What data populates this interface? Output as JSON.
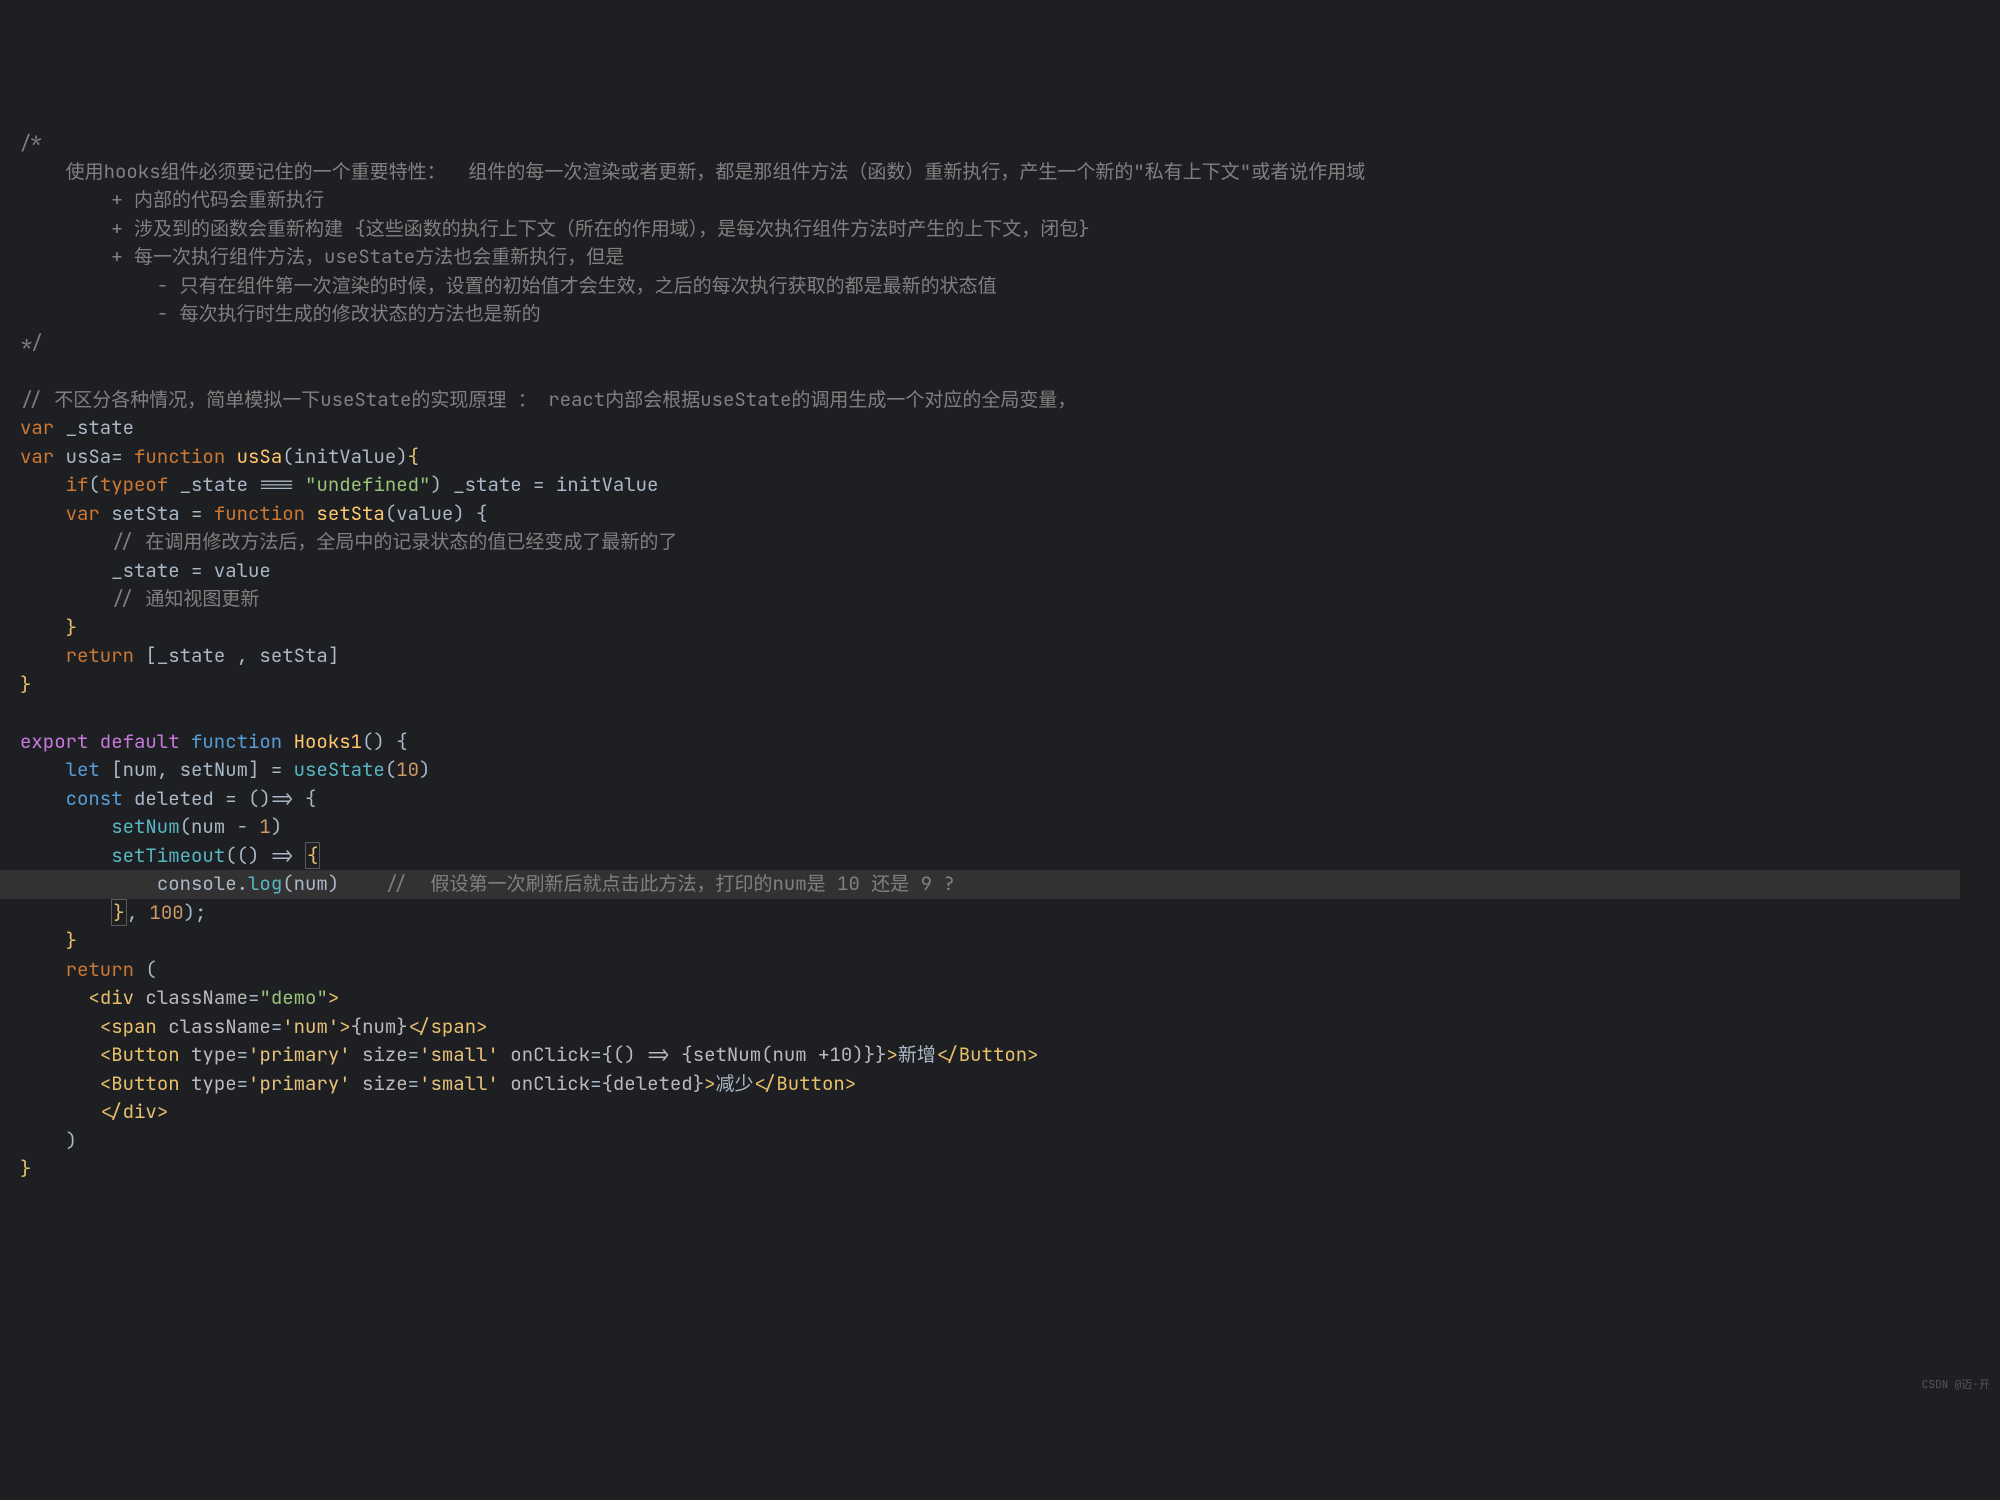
{
  "watermark": "CSDN @迈·开",
  "code": {
    "l1": "/*",
    "l2": "    使用hooks组件必须要记住的一个重要特性：  组件的每一次渲染或者更新，都是那组件方法（函数）重新执行，产生一个新的\"私有上下文\"或者说作用域",
    "l3": "        + 内部的代码会重新执行",
    "l4": "        + 涉及到的函数会重新构建 {这些函数的执行上下文（所在的作用域），是每次执行组件方法时产生的上下文，闭包}",
    "l5": "        + 每一次执行组件方法，useState方法也会重新执行，但是",
    "l6": "            - 只有在组件第一次渲染的时候，设置的初始值才会生效，之后的每次执行获取的都是最新的状态值",
    "l7": "            - 每次执行时生成的修改状态的方法也是新的",
    "l8": "*/",
    "l10": "// 不区分各种情况，简单模拟一下useState的实现原理 ： react内部会根据useState的调用生成一个对应的全局变量，",
    "l11_var": "var",
    "l11_state": " _state",
    "l12_var": "var",
    "l12_name": " usSa",
    "l12_eq": "= ",
    "l12_fn": "function",
    "l12_fnname": " usSa",
    "l12_param": "(initValue)",
    "l12_brace": "{",
    "l13_if": "if",
    "l13_typeof": "typeof",
    "l13_state": " _state ",
    "l13_eqeq": "=== ",
    "l13_str": "\"undefined\"",
    "l13_assign": " _state = initValue",
    "l14_var": "var",
    "l14_name": " setSta = ",
    "l14_fn": "function",
    "l14_fnname": " setSta",
    "l14_param": "(value) {",
    "l15": "// 在调用修改方法后，全局中的记录状态的值已经变成了最新的了",
    "l16": "_state = value",
    "l17": "// 通知视图更新",
    "l18": "}",
    "l19_return": "return",
    "l19_arr": " [_state , setSta]",
    "l20": "}",
    "l22_export": "export",
    "l22_default": " default",
    "l22_fn": " function",
    "l22_name": " Hooks1",
    "l22_end": "() {",
    "l23_let": "let",
    "l23_destr": " [num, setNum] = ",
    "l23_call": "useState",
    "l23_num": "10",
    "l24_const": "const",
    "l24_name": " deleted ",
    "l24_arrow": "= ()=> {",
    "l25_call": "setNum",
    "l25_expr": "(num - ",
    "l25_one": "1",
    "l26_call": "setTimeout",
    "l26_arrow": "(() => ",
    "l26_brace": "{",
    "l27_console": "console",
    "l27_log": "log",
    "l27_num": "(num)",
    "l27_comment": "//  假设第一次刷新后就点击此方法，打印的num是 10 还是 9 ?",
    "l28_close": "}",
    "l28_num": "100",
    "l29": "}",
    "l30_return": "return",
    "l30_paren": " (",
    "l31_div": "div",
    "l31_cn": " className",
    "l31_val": "\"demo\"",
    "l32_span": "span",
    "l32_cn": " className",
    "l32_val": "'num'",
    "l32_jsx": "{num}",
    "l33_btn": "Button",
    "l33_type": " type",
    "l33_tval": "'primary'",
    "l33_size": " size",
    "l33_sval": "'small'",
    "l33_click": " onClick",
    "l33_expr": "{() => {setNum(num +10)}}",
    "l33_text": "新增",
    "l34_btn": "Button",
    "l34_expr": "{deleted}",
    "l34_text": "减少",
    "l35_div": "div",
    "l36": ")",
    "l37": "}"
  }
}
